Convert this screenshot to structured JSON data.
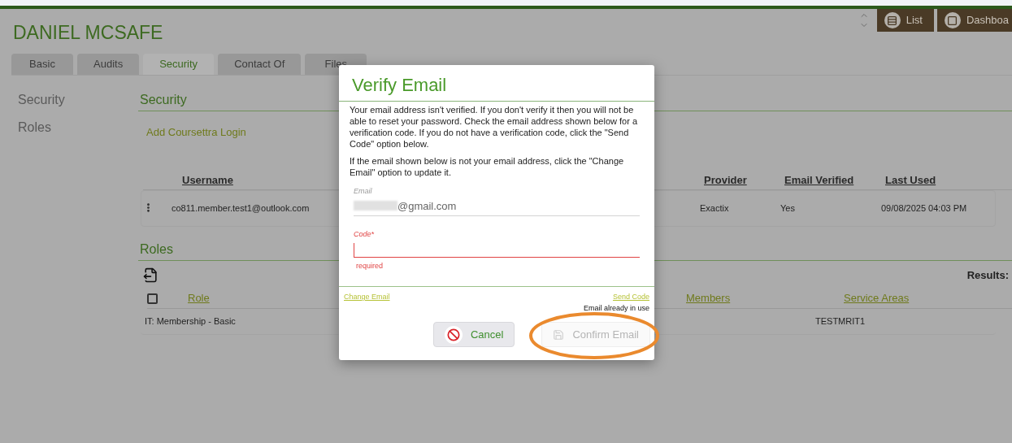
{
  "header": {
    "title": "DANIEL MCSAFE",
    "buttons": [
      {
        "label": "List",
        "kind": "list"
      },
      {
        "label": "Dashboa",
        "kind": "dashboard"
      }
    ]
  },
  "tabs": [
    {
      "label": "Basic",
      "selected": false
    },
    {
      "label": "Audits",
      "selected": false
    },
    {
      "label": "Security",
      "selected": true
    },
    {
      "label": "Contact Of",
      "selected": false
    },
    {
      "label": "Files",
      "selected": false
    }
  ],
  "side_nav": [
    {
      "label": "Security"
    },
    {
      "label": "Roles"
    }
  ],
  "security": {
    "heading": "Security",
    "add_link": "Add Coursettra Login",
    "columns": [
      "Username",
      "Provider",
      "Email Verified",
      "Last Used"
    ],
    "rows": [
      {
        "username": "co811.member.test1@outlook.com",
        "provider": "Exactix",
        "email_verified": "Yes",
        "last_used": "09/08/2025 04:03 PM"
      }
    ]
  },
  "roles": {
    "heading": "Roles",
    "results_label": "Results:",
    "select_all_checked": false,
    "columns": [
      "Role",
      "Members",
      "Service Areas"
    ],
    "rows": [
      {
        "role": "IT: Membership - Basic",
        "service_areas": "TESTMRIT1"
      }
    ]
  },
  "dialog": {
    "title": "Verify Email",
    "paragraphs": [
      "Your email address isn't verified. If you don't verify it then you will not be able to reset your password. Check the email address shown below for a verification code. If you do not have a verification code, click the \"Send Code\" option below.",
      "If the email shown below is not your email address, click the \"Change Email\" option to update it."
    ],
    "email": {
      "label": "Email",
      "value": "@gmail.com"
    },
    "code": {
      "label": "Code*",
      "error": "required"
    },
    "change_link": "Change Email",
    "send_link": "Send Code",
    "send_note": "Email already in use",
    "buttons": [
      {
        "label": "Cancel",
        "kind": "cancel",
        "disabled": false,
        "highlighted": false
      },
      {
        "label": "Confirm Email",
        "kind": "confirm",
        "disabled": true,
        "highlighted": true
      }
    ]
  }
}
